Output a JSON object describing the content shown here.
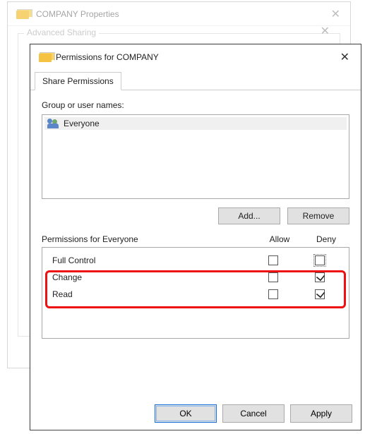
{
  "back_window": {
    "title": "COMPANY Properties",
    "group_label": "Advanced Sharing"
  },
  "front_window": {
    "title": "Permissions for COMPANY",
    "tab": "Share Permissions",
    "group_label": "Group or user names:",
    "list_items": [
      "Everyone"
    ],
    "add_button": "Add...",
    "remove_button": "Remove",
    "perm_label": "Permissions for Everyone",
    "col_allow": "Allow",
    "col_deny": "Deny",
    "permissions": [
      {
        "name": "Full Control",
        "allow": false,
        "deny": false
      },
      {
        "name": "Change",
        "allow": false,
        "deny": true
      },
      {
        "name": "Read",
        "allow": false,
        "deny": true
      }
    ],
    "highlight_rows": [
      "Change",
      "Read"
    ],
    "buttons": {
      "ok": "OK",
      "cancel": "Cancel",
      "apply": "Apply"
    }
  }
}
